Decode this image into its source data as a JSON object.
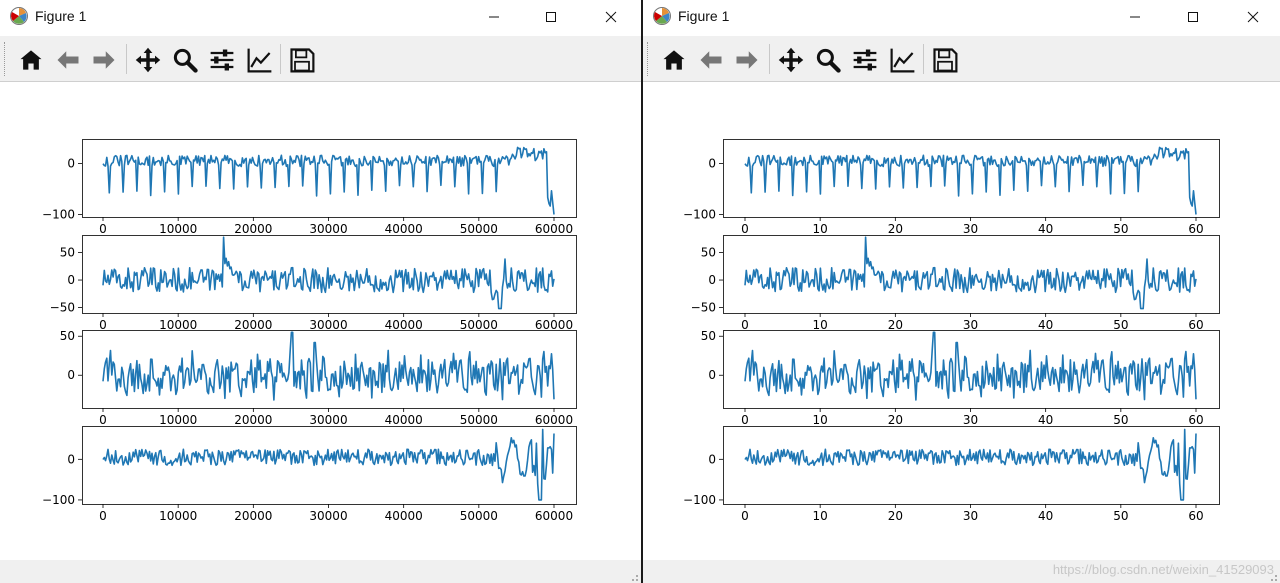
{
  "windows": [
    {
      "id": "left",
      "title": "Figure 1",
      "toolbar": [
        "home-icon",
        "back-icon",
        "forward-icon",
        "pan-icon",
        "zoom-icon",
        "configure-subplots-icon",
        "edit-axis-icon",
        "save-icon"
      ],
      "x_ticks": [
        "0",
        "10000",
        "20000",
        "30000",
        "40000",
        "50000",
        "60000"
      ],
      "x_max": 60000
    },
    {
      "id": "right",
      "title": "Figure 1",
      "toolbar": [
        "home-icon",
        "back-icon",
        "forward-icon",
        "pan-icon",
        "zoom-icon",
        "configure-subplots-icon",
        "edit-axis-icon",
        "save-icon"
      ],
      "x_ticks": [
        "0",
        "10",
        "20",
        "30",
        "40",
        "50",
        "60"
      ],
      "x_max": 60
    }
  ],
  "watermark": "https://blog.csdn.net/weixin_41529093",
  "colors": {
    "line": "#1f77b4",
    "toolbar": "#f0f0f0"
  },
  "chart_data": [
    {
      "type": "line",
      "panel": 1,
      "ylim": [
        -105,
        48
      ],
      "yticks": [
        "0",
        "−100"
      ],
      "ytick_values": [
        0,
        -100
      ],
      "series": [
        {
          "x_range_left": [
            0,
            60000
          ],
          "x_range_right": [
            0,
            60
          ],
          "baseline": 5,
          "amplitude": 12,
          "spike_min": -60,
          "tail_min": -100
        }
      ]
    },
    {
      "type": "line",
      "panel": 2,
      "ylim": [
        -60,
        82
      ],
      "yticks": [
        "50",
        "0",
        "−50"
      ],
      "ytick_values": [
        50,
        0,
        -50
      ],
      "series": [
        {
          "baseline": 0,
          "amplitude": 20,
          "peak": 78,
          "peak_at": 0.27,
          "min": -52
        }
      ]
    },
    {
      "type": "line",
      "panel": 3,
      "ylim": [
        -42,
        58
      ],
      "yticks": [
        "50",
        "0"
      ],
      "ytick_values": [
        50,
        0
      ],
      "series": [
        {
          "baseline": 0,
          "amplitude": 22,
          "peak": 55,
          "peak_at": 0.42,
          "min": -38
        }
      ]
    },
    {
      "type": "line",
      "panel": 4,
      "ylim": [
        -110,
        82
      ],
      "yticks": [
        "0",
        "−100"
      ],
      "ytick_values": [
        0,
        -100
      ],
      "series": [
        {
          "baseline": 5,
          "amplitude": 22,
          "peak": 78,
          "min": -100
        }
      ]
    }
  ]
}
